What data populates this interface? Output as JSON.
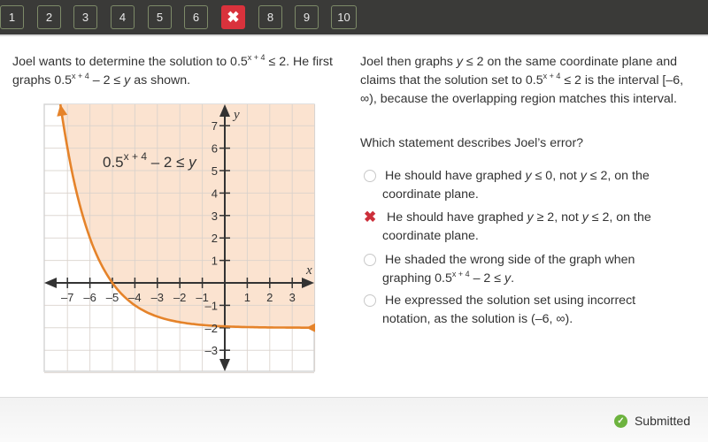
{
  "nav": {
    "buttons": [
      {
        "label": "1",
        "state": "default"
      },
      {
        "label": "2",
        "state": "default"
      },
      {
        "label": "3",
        "state": "default"
      },
      {
        "label": "4",
        "state": "default"
      },
      {
        "label": "5",
        "state": "default"
      },
      {
        "label": "6",
        "state": "default"
      },
      {
        "label": "✖",
        "state": "incorrect",
        "icon": "x-icon"
      },
      {
        "label": "8",
        "state": "default"
      },
      {
        "label": "9",
        "state": "default"
      },
      {
        "label": "10",
        "state": "default"
      }
    ]
  },
  "problem": {
    "intro_a": "Joel wants to determine the solution to 0.5",
    "intro_sup": "x + 4",
    "intro_b": " ≤ 2. He first graphs 0.5",
    "intro_sup2": "x + 4",
    "intro_c": " – 2 ≤ ",
    "intro_var": "y",
    "intro_d": " as shown.",
    "claim_a": "Joel then graphs ",
    "claim_var": "y",
    "claim_b": " ≤ 2 on the same coordinate plane and claims that the solution set to 0.5",
    "claim_sup": "x + 4",
    "claim_c": " ≤ 2 is the interval [–6, ∞), because the overlapping region matches this interval.",
    "question": "Which statement describes Joel’s error?"
  },
  "graph": {
    "label_base": "0.5",
    "label_sup": "x + 4",
    "label_rest": " – 2 ≤ ",
    "label_var": "y",
    "x_axis_label": "x",
    "y_axis_label": "y",
    "x_ticks": [
      "–7",
      "–6",
      "–5",
      "–4",
      "–3",
      "–2",
      "–1",
      "1",
      "2",
      "3"
    ],
    "x_tick_values": [
      -7,
      -6,
      -5,
      -4,
      -3,
      -2,
      -1,
      1,
      2,
      3
    ],
    "y_ticks": [
      "7",
      "6",
      "5",
      "4",
      "3",
      "2",
      "1",
      "–1",
      "–2",
      "–3"
    ],
    "y_tick_values": [
      7,
      6,
      5,
      4,
      3,
      2,
      1,
      -1,
      -2,
      -3
    ],
    "x_range": [
      -7.5,
      4.0
    ],
    "y_range": [
      -4.2,
      7.6
    ],
    "function": "0.5^(x+4) - 2",
    "shade": "above",
    "curve_color": "#e5832a",
    "shade_color": "#fbe3d0"
  },
  "options": [
    {
      "marker": "radio",
      "a": "He should have graphed ",
      "v1": "y",
      "b": " ≤ 0, not ",
      "v2": "y",
      "c": " ≤ 2, on the",
      "line2": "coordinate plane."
    },
    {
      "marker": "incorrect",
      "a": "He should have graphed ",
      "v1": "y",
      "b": " ≥ 2, not ",
      "v2": "y",
      "c": " ≤ 2, on the",
      "line2": "coordinate plane."
    },
    {
      "marker": "radio",
      "a": "He shaded the wrong side of the graph when",
      "line2a": "graphing 0.5",
      "line2sup": "x + 4",
      "line2b": " – 2 ≤ ",
      "line2var": "y",
      "line2c": "."
    },
    {
      "marker": "radio",
      "a": "He expressed the solution set using incorrect",
      "line2": "notation, as the solution is (–6, ∞)."
    }
  ],
  "footer": {
    "status": "Submitted",
    "status_color": "#6db33f"
  }
}
